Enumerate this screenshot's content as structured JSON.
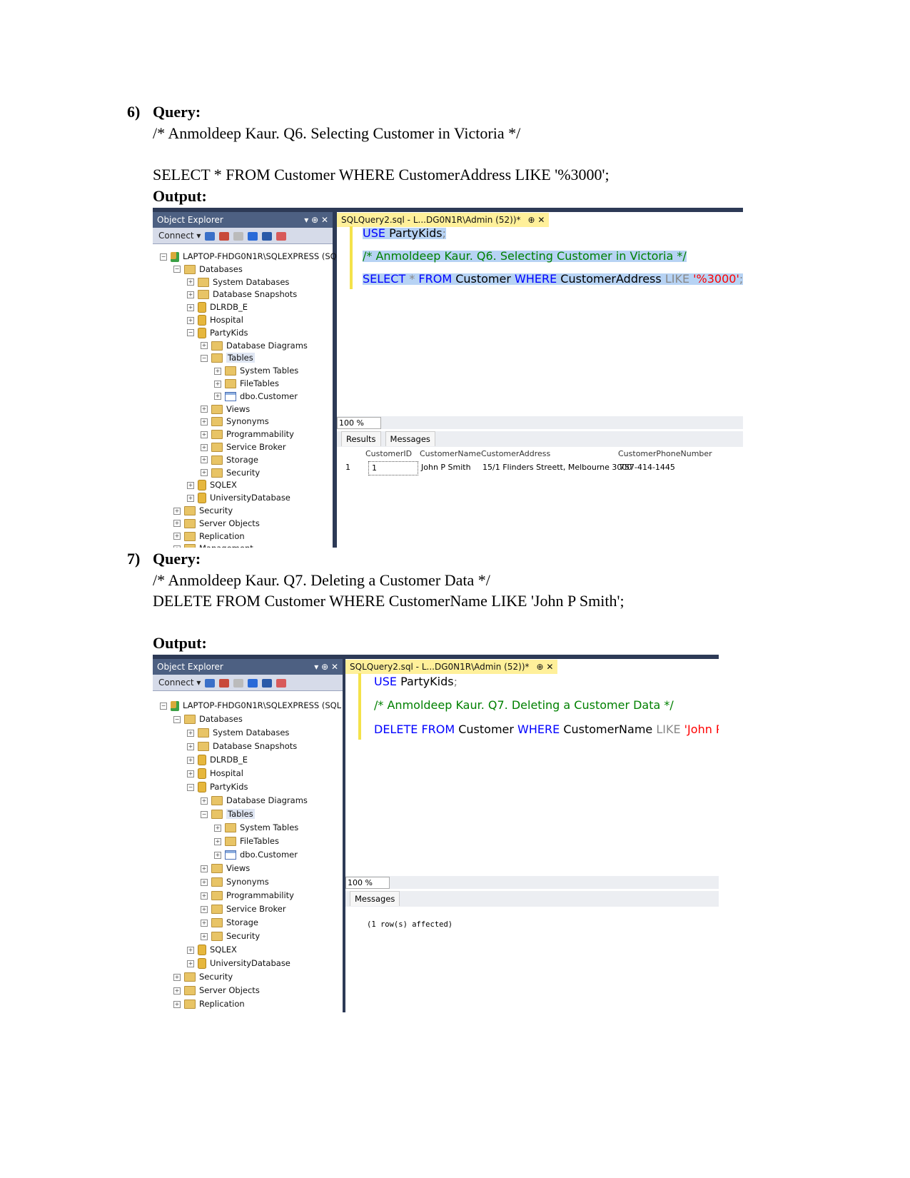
{
  "sections": [
    {
      "number": "6)",
      "query_label": "Query:",
      "comment": "/* Anmoldeep Kaur. Q6. Selecting Customer in Victoria */",
      "sql": "SELECT * FROM Customer WHERE CustomerAddress LIKE '%3000';",
      "output_label": "Output:"
    },
    {
      "number": "7)",
      "query_label": "Query:",
      "comment": "/* Anmoldeep Kaur. Q7. Deleting a Customer Data */",
      "sql": "DELETE FROM Customer WHERE CustomerName LIKE 'John P Smith';",
      "output_label": "Output:"
    }
  ],
  "object_explorer": {
    "title": "Object Explorer",
    "controls": "▾ ⊕ ✕",
    "connect": "Connect ▾",
    "tree": [
      {
        "level": 0,
        "icon": "server",
        "exp": "-",
        "label": "LAPTOP-FHDG0N1R\\SQLEXPRESS (SQL"
      },
      {
        "level": 1,
        "icon": "folder",
        "exp": "-",
        "label": "Databases"
      },
      {
        "level": 2,
        "icon": "folder",
        "exp": "+",
        "label": "System Databases"
      },
      {
        "level": 2,
        "icon": "folder",
        "exp": "+",
        "label": "Database Snapshots"
      },
      {
        "level": 2,
        "icon": "db",
        "exp": "+",
        "label": "DLRDB_E"
      },
      {
        "level": 2,
        "icon": "db",
        "exp": "+",
        "label": "Hospital"
      },
      {
        "level": 2,
        "icon": "db",
        "exp": "-",
        "label": "PartyKids"
      },
      {
        "level": 3,
        "icon": "folder",
        "exp": "+",
        "label": "Database Diagrams"
      },
      {
        "level": 3,
        "icon": "folder",
        "exp": "-",
        "label": "Tables",
        "selected": true
      },
      {
        "level": 4,
        "icon": "folder",
        "exp": "+",
        "label": "System Tables"
      },
      {
        "level": 4,
        "icon": "folder",
        "exp": "+",
        "label": "FileTables"
      },
      {
        "level": 4,
        "icon": "table",
        "exp": "+",
        "label": "dbo.Customer"
      },
      {
        "level": 3,
        "icon": "folder",
        "exp": "+",
        "label": "Views"
      },
      {
        "level": 3,
        "icon": "folder",
        "exp": "+",
        "label": "Synonyms"
      },
      {
        "level": 3,
        "icon": "folder",
        "exp": "+",
        "label": "Programmability"
      },
      {
        "level": 3,
        "icon": "folder",
        "exp": "+",
        "label": "Service Broker"
      },
      {
        "level": 3,
        "icon": "folder",
        "exp": "+",
        "label": "Storage"
      },
      {
        "level": 3,
        "icon": "folder",
        "exp": "+",
        "label": "Security"
      },
      {
        "level": 2,
        "icon": "db",
        "exp": "+",
        "label": "SQLEX"
      },
      {
        "level": 2,
        "icon": "db",
        "exp": "+",
        "label": "UniversityDatabase"
      },
      {
        "level": 1,
        "icon": "folder",
        "exp": "+",
        "label": "Security"
      },
      {
        "level": 1,
        "icon": "folder",
        "exp": "+",
        "label": "Server Objects"
      },
      {
        "level": 1,
        "icon": "folder",
        "exp": "+",
        "label": "Replication"
      },
      {
        "level": 1,
        "icon": "folder",
        "exp": "+",
        "label": "Management"
      }
    ]
  },
  "screens": [
    {
      "tab": "SQLQuery2.sql - L...DG0N1R\\Admin (52))*",
      "tab_controls": "⊕ ✕",
      "zoom": "100 %",
      "code": [
        [
          {
            "c": "kw",
            "t": "USE"
          },
          {
            "c": "",
            "t": " PartyKids"
          },
          {
            "c": "gr",
            "t": ";"
          }
        ],
        [
          {
            "c": "cm",
            "t": "/* Anmoldeep Kaur. Q6. Selecting Customer in Victoria */"
          }
        ],
        [
          {
            "c": "kw",
            "t": "SELECT"
          },
          {
            "c": "gr",
            "t": " * "
          },
          {
            "c": "kw",
            "t": "FROM"
          },
          {
            "c": "",
            "t": " Customer "
          },
          {
            "c": "kw",
            "t": "WHERE"
          },
          {
            "c": "",
            "t": " CustomerAddress "
          },
          {
            "c": "gr",
            "t": "LIKE"
          },
          {
            "c": "",
            "t": " "
          },
          {
            "c": "str",
            "t": "'%3000'"
          },
          {
            "c": "gr",
            "t": ";"
          }
        ]
      ],
      "result_tabs": [
        "Results",
        "Messages"
      ],
      "grid": {
        "columns": [
          "CustomerID",
          "CustomerName",
          "CustomerAddress",
          "CustomerPhoneNumber"
        ],
        "rows": [
          {
            "num": "1",
            "cells": [
              "1",
              "John P Smith",
              "15/1 Flinders Streett, Melbourne 3000",
              "757-414-1445"
            ]
          }
        ]
      }
    },
    {
      "tab": "SQLQuery2.sql - L...DG0N1R\\Admin (52))*",
      "tab_controls": "⊕ ✕",
      "zoom": "100 %",
      "code": [
        [
          {
            "c": "kw",
            "t": "USE"
          },
          {
            "c": "",
            "t": " PartyKids"
          },
          {
            "c": "gr",
            "t": ";"
          }
        ],
        [
          {
            "c": "cm",
            "t": "/* Anmoldeep Kaur. Q7. Deleting a Customer Data */"
          }
        ],
        [
          {
            "c": "kw",
            "t": "DELETE"
          },
          {
            "c": "",
            "t": " "
          },
          {
            "c": "kw",
            "t": "FROM"
          },
          {
            "c": "",
            "t": " Customer "
          },
          {
            "c": "kw",
            "t": "WHERE"
          },
          {
            "c": "",
            "t": " CustomerName "
          },
          {
            "c": "gr",
            "t": "LIKE"
          },
          {
            "c": "",
            "t": " "
          },
          {
            "c": "str",
            "t": "'John P Smith'"
          },
          {
            "c": "gr",
            "t": ";"
          }
        ]
      ],
      "result_tabs": [
        "Messages"
      ],
      "message": "(1 row(s) affected)"
    }
  ]
}
